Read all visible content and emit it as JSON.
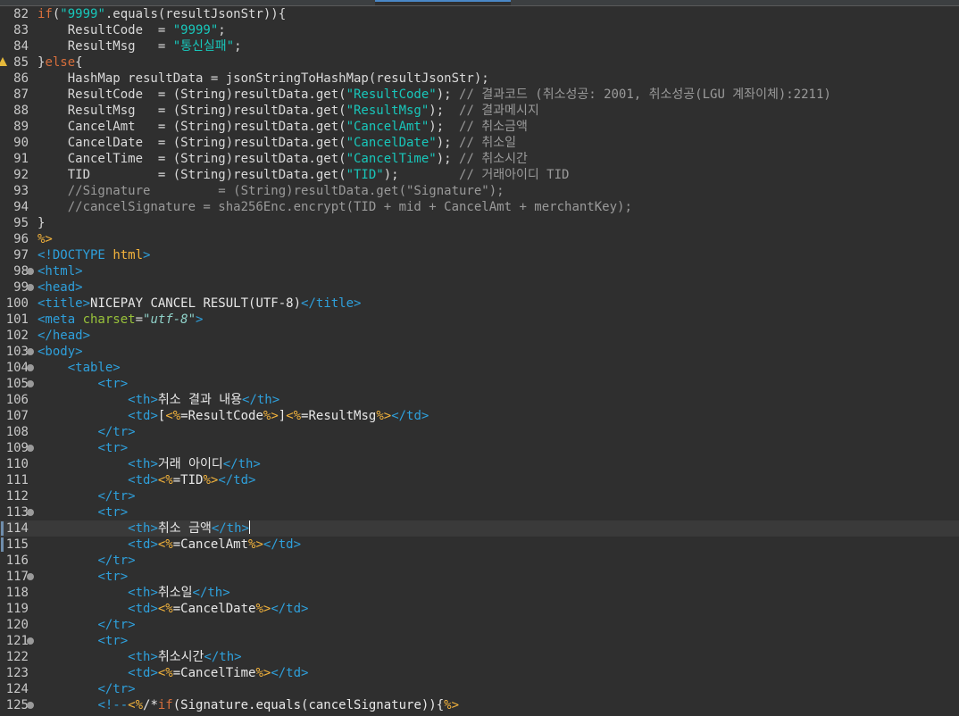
{
  "editor": {
    "lines": [
      {
        "num": "82",
        "tokens": [
          [
            "kw",
            "if"
          ],
          [
            "op",
            "("
          ],
          [
            "str",
            "\"9999\""
          ],
          [
            "op",
            ".equals(resultJsonStr)){"
          ]
        ]
      },
      {
        "num": "83",
        "tokens": [
          [
            "op",
            "    ResultCode  = "
          ],
          [
            "str",
            "\"9999\""
          ],
          [
            "op",
            ";"
          ]
        ]
      },
      {
        "num": "84",
        "tokens": [
          [
            "op",
            "    ResultMsg   = "
          ],
          [
            "str",
            "\"통신실패\""
          ],
          [
            "op",
            ";"
          ]
        ]
      },
      {
        "num": "85",
        "warn": true,
        "tokens": [
          [
            "op",
            "}"
          ],
          [
            "kw",
            "else"
          ],
          [
            "op",
            "{"
          ]
        ]
      },
      {
        "num": "86",
        "tokens": [
          [
            "op",
            "    HashMap resultData = jsonStringToHashMap(resultJsonStr);"
          ]
        ]
      },
      {
        "num": "87",
        "tokens": [
          [
            "op",
            "    ResultCode  = (String)resultData.get("
          ],
          [
            "str",
            "\"ResultCode\""
          ],
          [
            "op",
            "); "
          ],
          [
            "cm",
            "// 결과코드 (취소성공: 2001, 취소성공(LGU 계좌이체):2211)"
          ]
        ]
      },
      {
        "num": "88",
        "tokens": [
          [
            "op",
            "    ResultMsg   = (String)resultData.get("
          ],
          [
            "str",
            "\"ResultMsg\""
          ],
          [
            "op",
            ");  "
          ],
          [
            "cm",
            "// 결과메시지"
          ]
        ]
      },
      {
        "num": "89",
        "tokens": [
          [
            "op",
            "    CancelAmt   = (String)resultData.get("
          ],
          [
            "str",
            "\"CancelAmt\""
          ],
          [
            "op",
            ");  "
          ],
          [
            "cm",
            "// 취소금액"
          ]
        ]
      },
      {
        "num": "90",
        "tokens": [
          [
            "op",
            "    CancelDate  = (String)resultData.get("
          ],
          [
            "str",
            "\"CancelDate\""
          ],
          [
            "op",
            "); "
          ],
          [
            "cm",
            "// 취소일"
          ]
        ]
      },
      {
        "num": "91",
        "tokens": [
          [
            "op",
            "    CancelTime  = (String)resultData.get("
          ],
          [
            "str",
            "\"CancelTime\""
          ],
          [
            "op",
            "); "
          ],
          [
            "cm",
            "// 취소시간"
          ]
        ]
      },
      {
        "num": "92",
        "tokens": [
          [
            "op",
            "    TID         = (String)resultData.get("
          ],
          [
            "str",
            "\"TID\""
          ],
          [
            "op",
            ");        "
          ],
          [
            "cm",
            "// 거래아이디 TID"
          ]
        ]
      },
      {
        "num": "93",
        "tokens": [
          [
            "cm",
            "    //Signature         = (String)resultData.get(\"Signature\");"
          ]
        ]
      },
      {
        "num": "94",
        "tokens": [
          [
            "cm",
            "    //cancelSignature = sha256Enc.encrypt(TID + mid + CancelAmt + merchantKey);"
          ]
        ]
      },
      {
        "num": "95",
        "tokens": [
          [
            "op",
            "}"
          ]
        ]
      },
      {
        "num": "96",
        "tokens": [
          [
            "jsp",
            "%>"
          ]
        ]
      },
      {
        "num": "97",
        "tokens": [
          [
            "tag",
            "<!"
          ],
          [
            "doc",
            "DOCTYPE"
          ],
          [
            "op",
            " "
          ],
          [
            "jsp",
            "html"
          ],
          [
            "tag",
            ">"
          ]
        ]
      },
      {
        "num": "98",
        "fold": true,
        "tokens": [
          [
            "tag",
            "<html>"
          ]
        ]
      },
      {
        "num": "99",
        "fold": true,
        "tokens": [
          [
            "tag",
            "<head>"
          ]
        ]
      },
      {
        "num": "100",
        "tokens": [
          [
            "tag",
            "<title>"
          ],
          [
            "txt",
            "NICEPAY CANCEL RESULT(UTF-8)"
          ],
          [
            "tag",
            "</title>"
          ]
        ]
      },
      {
        "num": "101",
        "tokens": [
          [
            "tag",
            "<meta "
          ],
          [
            "attr",
            "charset"
          ],
          [
            "op",
            "="
          ],
          [
            "aval",
            "\"utf-8\""
          ],
          [
            "tag",
            ">"
          ]
        ]
      },
      {
        "num": "102",
        "tokens": [
          [
            "tag",
            "</head>"
          ]
        ]
      },
      {
        "num": "103",
        "fold": true,
        "tokens": [
          [
            "tag",
            "<body>"
          ]
        ]
      },
      {
        "num": "104",
        "fold": true,
        "tokens": [
          [
            "op",
            "    "
          ],
          [
            "tag",
            "<table>"
          ]
        ]
      },
      {
        "num": "105",
        "fold": true,
        "tokens": [
          [
            "op",
            "        "
          ],
          [
            "tag",
            "<tr>"
          ]
        ]
      },
      {
        "num": "106",
        "tokens": [
          [
            "op",
            "            "
          ],
          [
            "tag",
            "<th>"
          ],
          [
            "txt",
            "취소 결과 내용"
          ],
          [
            "tag",
            "</th>"
          ]
        ]
      },
      {
        "num": "107",
        "tokens": [
          [
            "op",
            "            "
          ],
          [
            "tag",
            "<td>"
          ],
          [
            "txt",
            "["
          ],
          [
            "jsp",
            "<%"
          ],
          [
            "txt",
            "=ResultCode"
          ],
          [
            "jsp",
            "%>"
          ],
          [
            "txt",
            "]"
          ],
          [
            "jsp",
            "<%"
          ],
          [
            "txt",
            "=ResultMsg"
          ],
          [
            "jsp",
            "%>"
          ],
          [
            "tag",
            "</td>"
          ]
        ]
      },
      {
        "num": "108",
        "tokens": [
          [
            "op",
            "        "
          ],
          [
            "tag",
            "</tr>"
          ]
        ]
      },
      {
        "num": "109",
        "fold": true,
        "tokens": [
          [
            "op",
            "        "
          ],
          [
            "tag",
            "<tr>"
          ]
        ]
      },
      {
        "num": "110",
        "tokens": [
          [
            "op",
            "            "
          ],
          [
            "tag",
            "<th>"
          ],
          [
            "txt",
            "거래 아이디"
          ],
          [
            "tag",
            "</th>"
          ]
        ]
      },
      {
        "num": "111",
        "tokens": [
          [
            "op",
            "            "
          ],
          [
            "tag",
            "<td>"
          ],
          [
            "jsp",
            "<%"
          ],
          [
            "txt",
            "=TID"
          ],
          [
            "jsp",
            "%>"
          ],
          [
            "tag",
            "</td>"
          ]
        ]
      },
      {
        "num": "112",
        "tokens": [
          [
            "op",
            "        "
          ],
          [
            "tag",
            "</tr>"
          ]
        ]
      },
      {
        "num": "113",
        "fold": true,
        "tokens": [
          [
            "op",
            "        "
          ],
          [
            "tag",
            "<tr>"
          ]
        ]
      },
      {
        "num": "114",
        "current": true,
        "changed": true,
        "cursor": true,
        "tokens": [
          [
            "op",
            "            "
          ],
          [
            "tag",
            "<th>"
          ],
          [
            "txt",
            "취소 금액"
          ],
          [
            "tag",
            "</th>"
          ]
        ]
      },
      {
        "num": "115",
        "changed": true,
        "tokens": [
          [
            "op",
            "            "
          ],
          [
            "tag",
            "<td>"
          ],
          [
            "jsp",
            "<%"
          ],
          [
            "txt",
            "=CancelAmt"
          ],
          [
            "jsp",
            "%>"
          ],
          [
            "tag",
            "</td>"
          ]
        ]
      },
      {
        "num": "116",
        "tokens": [
          [
            "op",
            "        "
          ],
          [
            "tag",
            "</tr>"
          ]
        ]
      },
      {
        "num": "117",
        "fold": true,
        "tokens": [
          [
            "op",
            "        "
          ],
          [
            "tag",
            "<tr>"
          ]
        ]
      },
      {
        "num": "118",
        "tokens": [
          [
            "op",
            "            "
          ],
          [
            "tag",
            "<th>"
          ],
          [
            "txt",
            "취소일"
          ],
          [
            "tag",
            "</th>"
          ]
        ]
      },
      {
        "num": "119",
        "tokens": [
          [
            "op",
            "            "
          ],
          [
            "tag",
            "<td>"
          ],
          [
            "jsp",
            "<%"
          ],
          [
            "txt",
            "=CancelDate"
          ],
          [
            "jsp",
            "%>"
          ],
          [
            "tag",
            "</td>"
          ]
        ]
      },
      {
        "num": "120",
        "tokens": [
          [
            "op",
            "        "
          ],
          [
            "tag",
            "</tr>"
          ]
        ]
      },
      {
        "num": "121",
        "fold": true,
        "tokens": [
          [
            "op",
            "        "
          ],
          [
            "tag",
            "<tr>"
          ]
        ]
      },
      {
        "num": "122",
        "tokens": [
          [
            "op",
            "            "
          ],
          [
            "tag",
            "<th>"
          ],
          [
            "txt",
            "취소시간"
          ],
          [
            "tag",
            "</th>"
          ]
        ]
      },
      {
        "num": "123",
        "tokens": [
          [
            "op",
            "            "
          ],
          [
            "tag",
            "<td>"
          ],
          [
            "jsp",
            "<%"
          ],
          [
            "txt",
            "=CancelTime"
          ],
          [
            "jsp",
            "%>"
          ],
          [
            "tag",
            "</td>"
          ]
        ]
      },
      {
        "num": "124",
        "tokens": [
          [
            "op",
            "        "
          ],
          [
            "tag",
            "</tr>"
          ]
        ]
      },
      {
        "num": "125",
        "fold": true,
        "tokens": [
          [
            "op",
            "        "
          ],
          [
            "tag",
            "<!--"
          ],
          [
            "jsp",
            "<%"
          ],
          [
            "txt",
            "/*"
          ],
          [
            "kw",
            "if"
          ],
          [
            "txt",
            "(Signature.equals(cancelSignature)){"
          ],
          [
            "jsp",
            "%>"
          ]
        ]
      }
    ]
  }
}
